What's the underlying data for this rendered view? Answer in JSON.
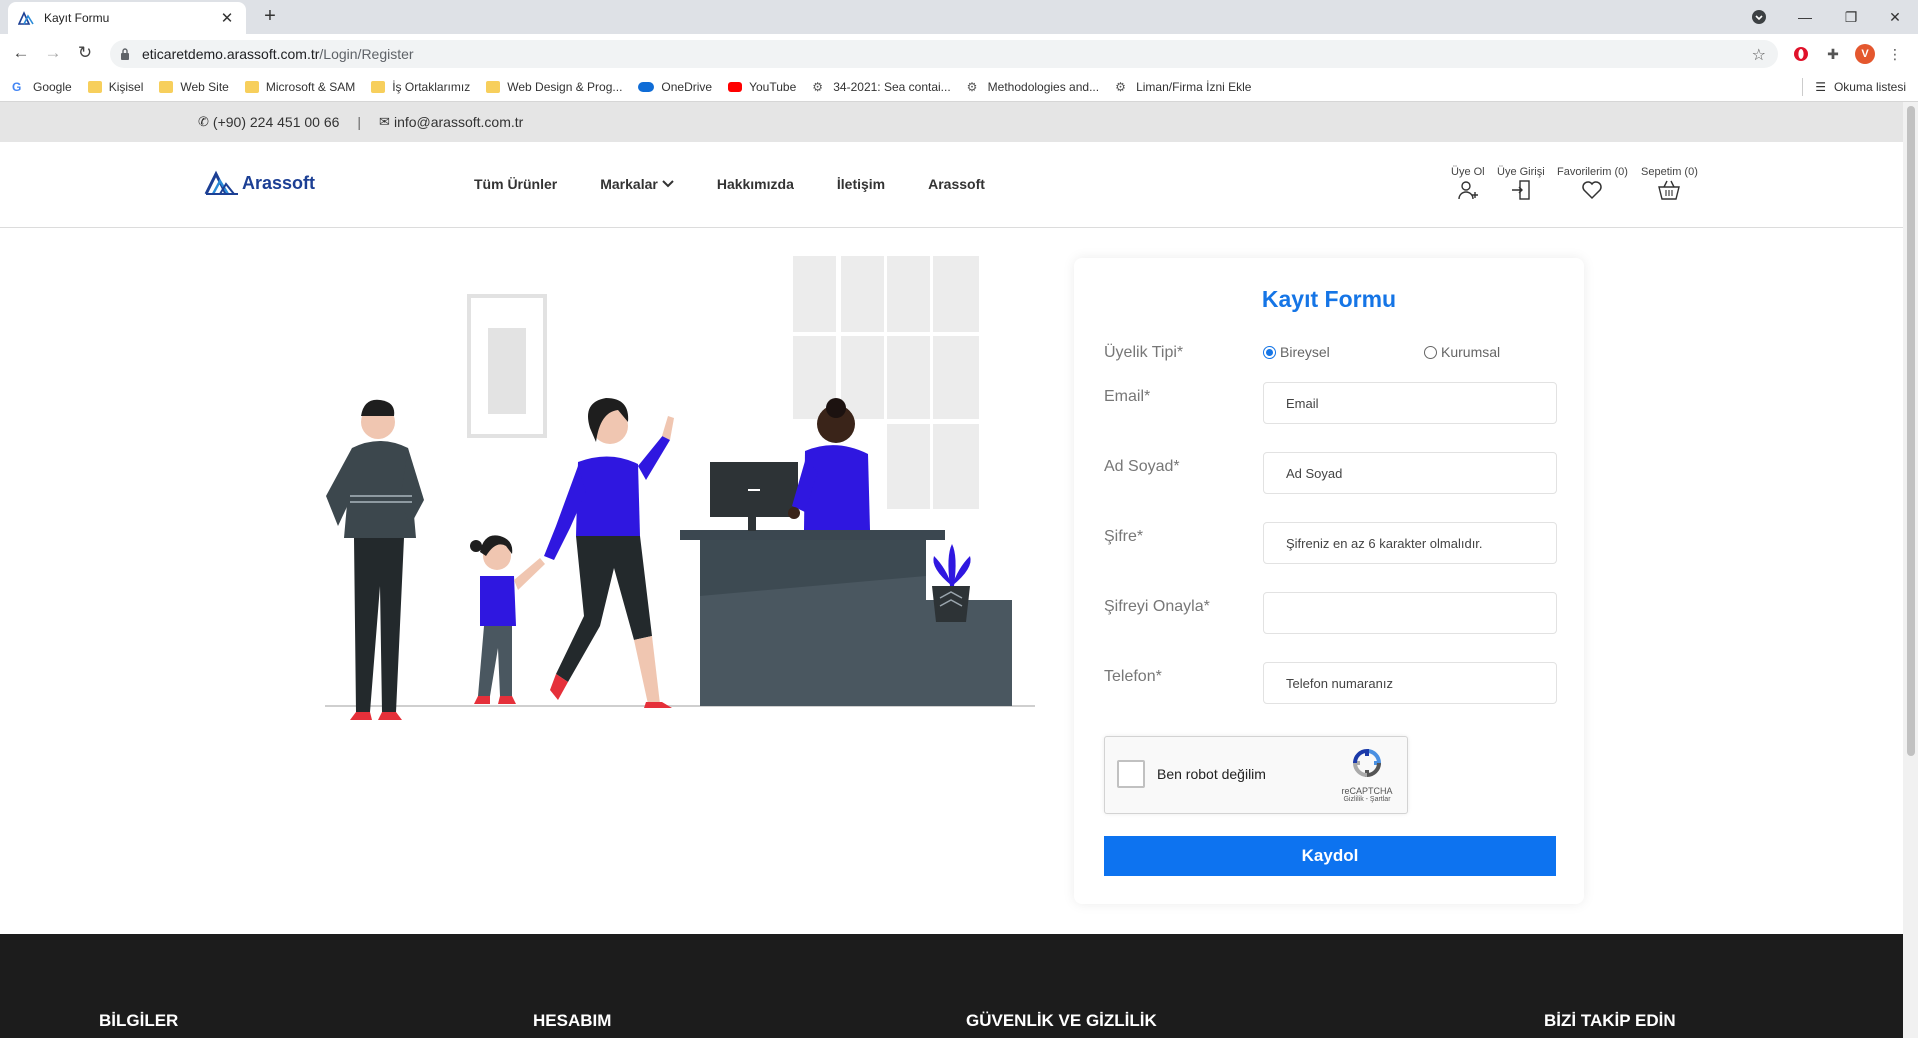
{
  "browser": {
    "tab_title": "Kayıt Formu",
    "url_host": "eticaretdemo.arassoft.com.tr",
    "url_path": "/Login/Register",
    "profile_initial": "V",
    "bookmarks": [
      {
        "label": "Google",
        "icon": "google-icon"
      },
      {
        "label": "Kişisel",
        "icon": "folder-icon"
      },
      {
        "label": "Web Site",
        "icon": "folder-icon"
      },
      {
        "label": "Microsoft & SAM",
        "icon": "folder-icon"
      },
      {
        "label": "İş Ortaklarımız",
        "icon": "folder-icon"
      },
      {
        "label": "Web Design & Prog...",
        "icon": "folder-icon"
      },
      {
        "label": "OneDrive",
        "icon": "onedrive-icon"
      },
      {
        "label": "YouTube",
        "icon": "youtube-icon"
      },
      {
        "label": "34-2021: Sea contai...",
        "icon": "site-icon"
      },
      {
        "label": "Methodologies and...",
        "icon": "site-icon"
      },
      {
        "label": "Liman/Firma İzni Ekle",
        "icon": "site-icon"
      }
    ],
    "reading_list": "Okuma listesi"
  },
  "topbar": {
    "phone": "(+90) 224 451 00 66",
    "divider": "|",
    "email": "info@arassoft.com.tr"
  },
  "header": {
    "logo_text": "Arassoft",
    "nav": [
      "Tüm Ürünler",
      "Markalar",
      "Hakkımızda",
      "İletişim",
      "Arassoft"
    ],
    "user_actions": {
      "register": "Üye Ol",
      "login": "Üye Girişi",
      "favorites": "Favorilerim (0)",
      "cart": "Sepetim (0)"
    }
  },
  "form": {
    "title": "Kayıt Formu",
    "membership_label": "Üyelik Tipi*",
    "membership_options": [
      "Bireysel",
      "Kurumsal"
    ],
    "membership_selected": "Bireysel",
    "email_label": "Email*",
    "email_placeholder": "Email",
    "name_label": "Ad Soyad*",
    "name_placeholder": "Ad Soyad",
    "password_label": "Şifre*",
    "password_placeholder": "Şifreniz en az 6 karakter olmalıdır.",
    "confirm_label": "Şifreyi Onayla*",
    "confirm_placeholder": "",
    "phone_label": "Telefon*",
    "phone_placeholder": "Telefon numaranız",
    "captcha_text": "Ben robot değilim",
    "captcha_brand": "reCAPTCHA",
    "captcha_terms": "Gizlilik - Şartlar",
    "submit_label": "Kaydol"
  },
  "footer": {
    "headings": [
      "BİLGİLER",
      "HESABIM",
      "GÜVENLİK VE GİZLİLİK",
      "BİZİ TAKİP EDİN"
    ]
  },
  "colors": {
    "accent": "#1575e6",
    "button": "#0d73f0",
    "illustration_blue": "#2f17e0",
    "illustration_dark": "#455560",
    "footer_bg": "#1c1c1c"
  }
}
